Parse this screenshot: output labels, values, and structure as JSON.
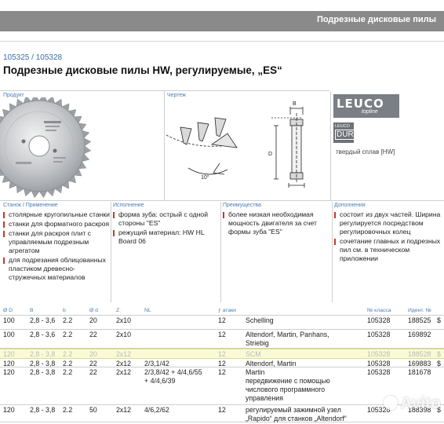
{
  "header": {
    "band_title": "Подрезные дисковые пилы"
  },
  "product": {
    "codes": "105325 / 105328",
    "title": "Подрезные дисковые пилы HW, регулируемые, „ES“"
  },
  "sections": {
    "product_label": "Продукт",
    "drawing_label": "Чертеж",
    "drawing_dim_b": "B",
    "drawing_dim_d": "D"
  },
  "brand": {
    "leuco": "LEUCO",
    "leuco_sub": "topline",
    "dur_top": "LEUCO",
    "dur": "DUR",
    "carbide": "твердый сплав [HW]"
  },
  "columns": [
    {
      "heading": "Станок / Применение",
      "items": [
        "столярные кругопильные станки",
        "станки для форматного раскроя",
        "станки для раскроя плит с управляемым подрезным агрегатом",
        "для подрезания облицованных пластиком древесно-стружечных материалов"
      ]
    },
    {
      "heading": "Исполнение",
      "items": [
        "форма зуба: острый с одной стороны \"ES\"",
        "режущий материал: HW HL Board 06"
      ]
    },
    {
      "heading": "Преимущества",
      "items": [
        "более низкая необходимая мощность двигателя за счет формы зуба \"ES\""
      ]
    },
    {
      "heading": "Дополнения",
      "items": [
        "состоит из двух частей. Ширина регулируется посредством регулировочных колец",
        "сочетание главных и подрезных пил см. в техническом приложении"
      ]
    }
  ],
  "table": {
    "headers": {
      "d_out": "Ø D",
      "b": "B",
      "b_small": "b",
      "d_bore": "Ø d",
      "z": "Z",
      "nl": "NL",
      "ata": "ƒ атаки",
      "class": "№ класса",
      "ident": "Идент. №"
    },
    "rows": [
      {
        "d_out": "100",
        "b": "2,8 - 3,6",
        "b_small": "2.2",
        "d_bore": "20",
        "z": "2x10",
        "nl": "",
        "ata": "12",
        "machine": [
          "Schelling"
        ],
        "class": "105328",
        "ident": "188525",
        "cur": "$"
      },
      {
        "d_out": "100",
        "b": "2,8 - 3,6",
        "b_small": "2.2",
        "d_bore": "22",
        "z": "2x10",
        "nl": "",
        "ata": "12",
        "machine": [
          "Altendorf, Martin, Panhans,",
          "Striebig"
        ],
        "class": "105328",
        "ident": "169892",
        "cur": ""
      },
      {
        "d_out": "120",
        "b": "2,8 - 3,8",
        "b_small": "2.2",
        "d_bore": "20",
        "z": "2x12",
        "nl": "",
        "ata": "12",
        "machine": [
          "SCM"
        ],
        "class": "105328",
        "ident": "188528",
        "cur": "$"
      },
      {
        "d_out": "120",
        "b": "2,8 - 3,8",
        "b_small": "2.2",
        "d_bore": "22",
        "z": "2x12",
        "nl": "2/3,1/42",
        "ata": "12",
        "machine": [
          "Altendorf, Martin"
        ],
        "class": "105328",
        "ident": "169883",
        "cur": "$"
      },
      {
        "d_out": "120",
        "b": "2,8 - 3,8",
        "b_small": "2.2",
        "d_bore": "22",
        "z": "2x12",
        "nl": "2/3,8/42 + 4/4,6/55\n+ 4/4,6/39",
        "ata": "12",
        "machine": [
          "Martin",
          "передвижение с помощью",
          "числового программного",
          "управления"
        ],
        "class": "105328",
        "ident": "181678",
        "cur": ""
      },
      {
        "d_out": "120",
        "b": "2,8 - 3,8",
        "b_small": "2.2",
        "d_bore": "50",
        "z": "2x12",
        "nl": "4/6,2/62",
        "ata": "12",
        "machine": [
          "регулируемый зажимной узел",
          "„Rapido“ для станков „Altendorf“"
        ],
        "class": "105328",
        "ident": "188398",
        "cur": "$"
      }
    ]
  },
  "watermark": {
    "text": "Avito"
  }
}
